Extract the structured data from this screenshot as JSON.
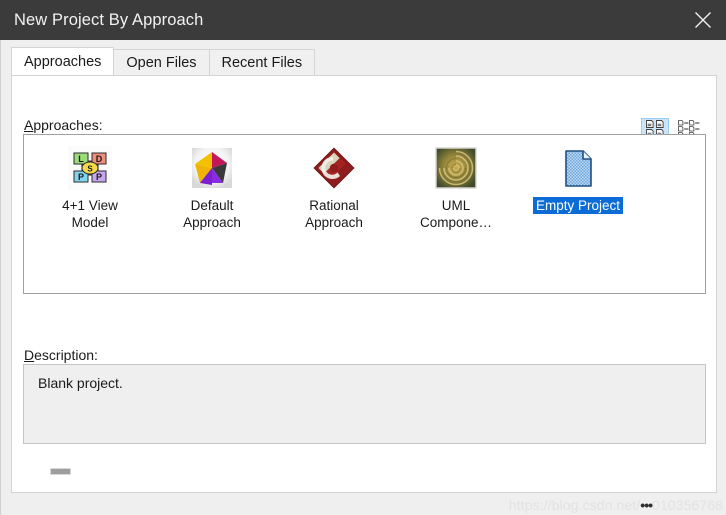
{
  "window": {
    "title": "New Project By Approach",
    "close_icon": "close-icon",
    "titlebar_color": "#3b3b3b",
    "accent_color": "#0a6cd4"
  },
  "tabs": [
    {
      "label": "Approaches",
      "active": true
    },
    {
      "label": "Open Files",
      "active": false
    },
    {
      "label": "Recent Files",
      "active": false
    }
  ],
  "approaches_section": {
    "label_accel": "A",
    "label_rest": "pproaches:",
    "view_modes": [
      {
        "name": "large-icons-view-button",
        "icon": "grid-icons-icon",
        "active": true
      },
      {
        "name": "list-view-button",
        "icon": "list-view-icon",
        "active": false
      }
    ],
    "items": [
      {
        "label": "4+1 View\nModel",
        "icon": "four-plus-one-view-model-icon",
        "selected": false
      },
      {
        "label": "Default\nApproach",
        "icon": "star-icon",
        "selected": false
      },
      {
        "label": "Rational\nApproach",
        "icon": "rational-diamond-icon",
        "selected": false
      },
      {
        "label": "UML\nCompone…",
        "icon": "uml-component-spiral-icon",
        "selected": false
      },
      {
        "label": "Empty Project",
        "icon": "empty-document-icon",
        "selected": true
      }
    ]
  },
  "description_section": {
    "label_accel": "D",
    "label_rest": "escription:",
    "text": "Blank project."
  },
  "watermark": {
    "prefix": "https://blog.csdn.net/",
    "dots": "•••",
    "suffix": "010356768"
  }
}
